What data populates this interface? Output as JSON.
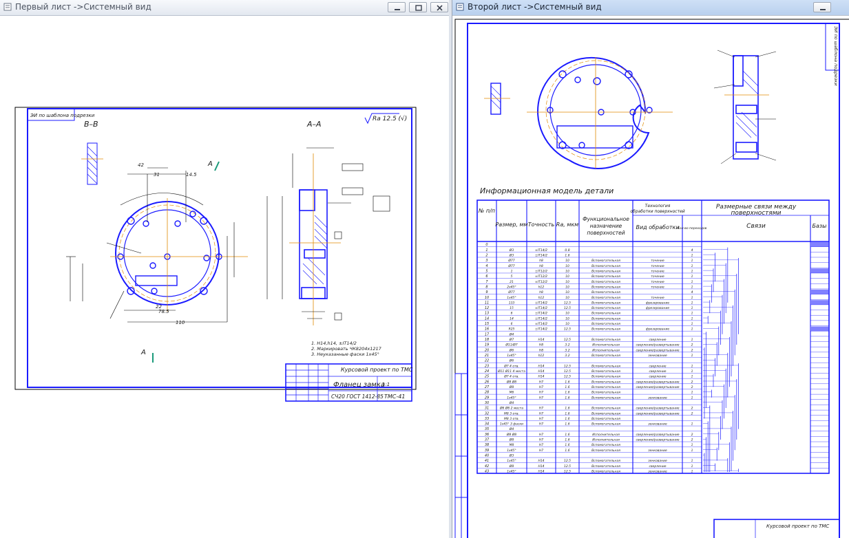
{
  "window1": {
    "title": "Первый лист ->Системный вид",
    "buttons": [
      "minimize",
      "restore",
      "close"
    ],
    "sheet": {
      "corner_stamp": "ЭИ по шаблона подрезки",
      "roughness": "Ra 12.5 (√)",
      "view_b": "В–В",
      "view_a": "А–А",
      "section_mark": "А",
      "dims": [
        "42",
        "31",
        "14.5",
        "40",
        "45°",
        "21",
        "20",
        "78.5",
        "110",
        "22",
        "14",
        "21",
        "1x45°",
        "2 фаски",
        "15",
        "12",
        "96",
        "1.4",
        "8°"
      ],
      "notes": [
        "1. Н14,h14, ±IT14/2",
        "2. Маркировать ЧК8204х1217",
        "3. Неуказанные фаски 1х45°"
      ],
      "stamp_title": "Курсовой проект по ТМС",
      "stamp_name": "Фланец замка",
      "stamp_material": "СЧ20 ГОСТ 1412-85",
      "stamp_code": "ТМС-41",
      "stamp_sheets": [
        "1:1",
        "1:1"
      ]
    }
  },
  "window2": {
    "title": "Второй лист ->Системный вид",
    "buttons": [
      "minimize"
    ],
    "sheet": {
      "corner_stamp": "ЭИ по шаблона подрезки",
      "table_title": "Информационная модель детали",
      "columns": [
        "№ п/п",
        "Размер, мм",
        "Точность",
        "Ra, мкм",
        "Функциональное назначение поверхностей",
        "Технология обработки поверхностей",
        "Вид обработки",
        "Кол-во переходов",
        "Размерные связи между поверхностями",
        "Связи",
        "Базы"
      ],
      "rows": [
        [
          "0",
          "",
          "",
          "",
          "",
          "",
          "",
          "",
          ""
        ],
        [
          "1",
          "Ø3",
          "±IT14/2",
          "0.8",
          "",
          "",
          "",
          "4"
        ],
        [
          "2",
          "Ø3",
          "±IT14/2",
          "1.6",
          "",
          "",
          "",
          "1"
        ],
        [
          "3",
          "Ø77",
          "h8",
          "10",
          "Вспомогательная",
          "",
          "точение",
          "1"
        ],
        [
          "4",
          "Ø77",
          "h8",
          "10",
          "Вспомогательная",
          "",
          "точение",
          "1"
        ],
        [
          "5",
          "1",
          "±IT12/2",
          "10",
          "Вспомогательная",
          "",
          "точение",
          "1"
        ],
        [
          "6",
          "5",
          "±IT12/2",
          "10",
          "Вспомогательная",
          "",
          "точение",
          "1"
        ],
        [
          "7",
          "21",
          "±IT12/2",
          "10",
          "Вспомогательная",
          "",
          "точение",
          "1"
        ],
        [
          "8",
          "2x45°",
          "h12",
          "10",
          "Вспомогательная",
          "",
          "точение",
          "1"
        ],
        [
          "9",
          "Ø77",
          "h8",
          "10",
          "Вспомогательная",
          "",
          "",
          "4"
        ],
        [
          "10",
          "1x45°",
          "h12",
          "10",
          "Вспомогательная",
          "",
          "точение",
          "1"
        ],
        [
          "11",
          "133",
          "±IT14/2",
          "12.5",
          "Вспомогательная",
          "",
          "фрезерование",
          "1"
        ],
        [
          "12",
          "15",
          "±IT14/2",
          "12.5",
          "Вспомогательная",
          "",
          "фрезерование",
          "1"
        ],
        [
          "13",
          "6",
          "±IT14/2",
          "10",
          "Вспомогательная",
          "",
          "",
          "1"
        ],
        [
          "14",
          "14",
          "±IT14/2",
          "10",
          "Вспомогательная",
          "",
          "",
          "1"
        ],
        [
          "15",
          "6",
          "±IT14/2",
          "10",
          "Вспомогательная",
          "",
          "",
          "1"
        ],
        [
          "16",
          "R25",
          "±IT14/2",
          "12.5",
          "Вспомогательная",
          "",
          "фрезерование",
          "1"
        ],
        [
          "17",
          "Ø4",
          "",
          "",
          "",
          "",
          "",
          ""
        ],
        [
          "18",
          "Ø7",
          "H14",
          "12.5",
          "Вспомогательная",
          "",
          "сверление",
          "1"
        ],
        [
          "19",
          "Ø11/Ø7",
          "H8",
          "3.2",
          "Исполнительная",
          "",
          "сверление/развертывание",
          "2"
        ],
        [
          "20",
          "Ø6",
          "H8",
          "3.2",
          "Исполнительная",
          "",
          "сверление/развертывание",
          "2"
        ],
        [
          "21",
          "1x45°",
          "h12",
          "3.2",
          "Вспомогательная",
          "",
          "зенкование",
          "1"
        ],
        [
          "22",
          "Ø6",
          "",
          "",
          "",
          "",
          "",
          ""
        ],
        [
          "23",
          "Ø7 4 отв.",
          "H14",
          "12.5",
          "Вспомогательная",
          "",
          "сверление",
          "1"
        ],
        [
          "24",
          "Ø11 Ø11 4 места",
          "H14",
          "12.5",
          "Вспомогательная",
          "",
          "сверление",
          "1"
        ],
        [
          "25",
          "Ø7 4 отв.",
          "H14",
          "12.5",
          "Вспомогательная",
          "",
          "сверление",
          "1"
        ],
        [
          "26",
          "Ø8 Ø8",
          "H7",
          "1.6",
          "Вспомогательная",
          "",
          "сверление/развертывание",
          "2"
        ],
        [
          "27",
          "Ø8",
          "H7",
          "1.6",
          "Вспомогательная",
          "",
          "сверление/развертывание",
          "2"
        ],
        [
          "28",
          "M6",
          "H7",
          "1.6",
          "Вспомогательная",
          "",
          "",
          "1"
        ],
        [
          "29",
          "1x45°",
          "H7",
          "1.6",
          "Вспомогательная",
          "",
          "зенкование",
          "1"
        ],
        [
          "30",
          "Ø4",
          "",
          "",
          "",
          "",
          "",
          ""
        ],
        [
          "31",
          "Ø6 Ø6 2 места",
          "H7",
          "1.6",
          "Вспомогательная",
          "",
          "сверление/развертывание",
          "2"
        ],
        [
          "32",
          "M8 3 отв.",
          "H7",
          "1.6",
          "Вспомогательная",
          "",
          "сверление/развертывание",
          "2"
        ],
        [
          "33",
          "M8 3 отв.",
          "H7",
          "1.6",
          "Вспомогательная",
          "",
          "",
          ""
        ],
        [
          "34",
          "1x45° 3 фаски",
          "H7",
          "1.6",
          "Вспомогательная",
          "",
          "зенкование",
          "1"
        ],
        [
          "35",
          "Ø4",
          "",
          "",
          "",
          "",
          "",
          ""
        ],
        [
          "36",
          "Ø8 Ø8",
          "H7",
          "1.6",
          "Исполнительная",
          "",
          "сверление/развертывание",
          "2"
        ],
        [
          "37",
          "Ø8",
          "H7",
          "1.6",
          "Исполнительная",
          "",
          "сверление/развертывание",
          "2"
        ],
        [
          "38",
          "M8",
          "H7",
          "1.6",
          "Вспомогательная",
          "",
          "",
          "1"
        ],
        [
          "39",
          "1x45°",
          "H7",
          "1.6",
          "Вспомогательная",
          "",
          "зенкование",
          "1"
        ],
        [
          "40",
          "Ø3",
          "",
          "",
          "",
          "",
          "",
          ""
        ],
        [
          "41",
          "1x45°",
          "H14",
          "12.5",
          "Вспомогательная",
          "",
          "зенкование",
          "1"
        ],
        [
          "42",
          "Ø8",
          "H14",
          "12.5",
          "Вспомогательная",
          "",
          "сверление",
          "1"
        ],
        [
          "43",
          "1x45°",
          "H14",
          "12.5",
          "Вспомогательная",
          "",
          "зенкование",
          "1"
        ]
      ],
      "stamp_title": "Курсовой проект по ТМС"
    }
  },
  "colors": {
    "frame": "#1a1aff",
    "center": "#e08a00",
    "hatch": "#1a1aff",
    "titlebar_active": "#c4d8f2",
    "titlebar_inactive": "#eef1f6"
  }
}
